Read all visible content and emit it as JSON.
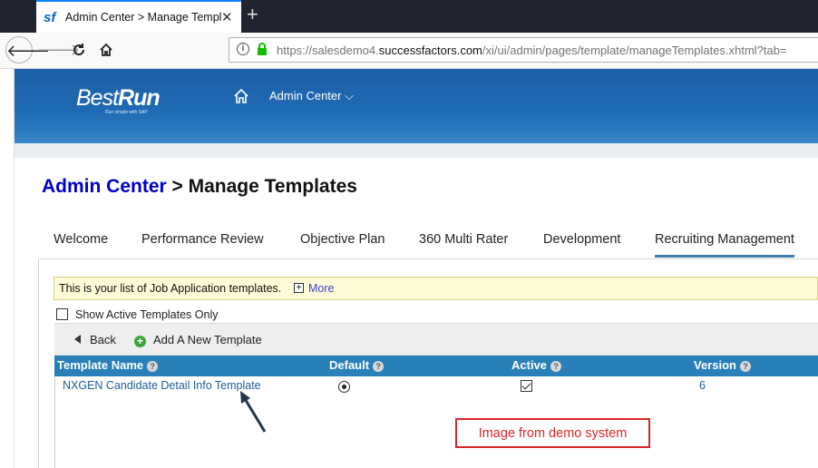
{
  "browser": {
    "tab_favicon": "sf",
    "tab_title": "Admin Center > Manage Templ",
    "tab_close": "✕",
    "new_tab": "+",
    "url_prefix": "https://salesdemo4.",
    "url_domain": "successfactors.com",
    "url_path": "/xi/ui/admin/pages/template/manageTemplates.xhtml?tab="
  },
  "header": {
    "logo_best": "Best",
    "logo_run": "Run",
    "logo_tagline": "Run simple with SAP",
    "menu_label": "Admin Center ⌵"
  },
  "page": {
    "breadcrumb_link": "Admin Center",
    "title_rest": " > Manage Templates",
    "tabs": [
      {
        "label": "Welcome"
      },
      {
        "label": "Performance Review"
      },
      {
        "label": "Objective Plan"
      },
      {
        "label": "360 Multi Rater"
      },
      {
        "label": "Development"
      },
      {
        "label": "Recruiting Management"
      }
    ],
    "info_text": "This is your list of Job Application templates.",
    "info_plus": "+",
    "info_more": "More",
    "show_active_label": "Show Active Templates Only",
    "back_label": "Back",
    "add_label": "Add A New Template",
    "add_icon_glyph": "+",
    "help_glyph": "?",
    "columns": [
      "Template Name",
      "Default",
      "Active",
      "Version"
    ],
    "rows": [
      {
        "name": "NXGEN Candidate Detail Info Template",
        "default": true,
        "active": true,
        "version": "6"
      }
    ]
  },
  "annotation": {
    "text": "Image from demo system",
    "color": "#d9262a"
  },
  "colors": {
    "header_blue": "#1f6bb5",
    "table_header": "#2980b9",
    "link": "#1f5d9a",
    "info_bg": "#fffbd6"
  }
}
